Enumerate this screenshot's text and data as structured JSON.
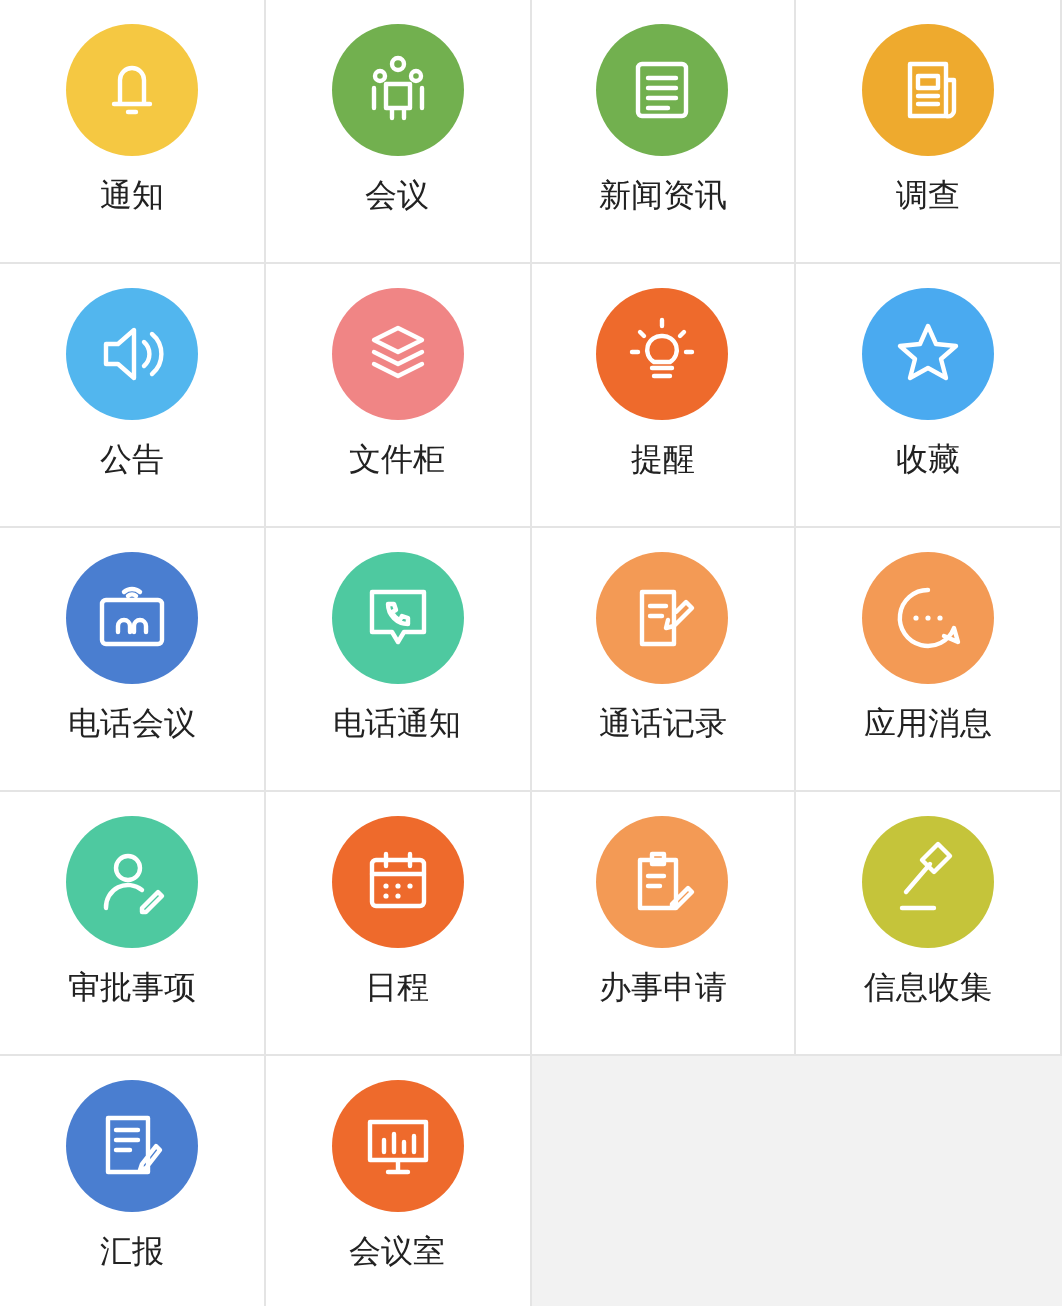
{
  "tiles": [
    {
      "label": "通知",
      "kind": "bell",
      "color": "#f5c842"
    },
    {
      "label": "会议",
      "kind": "meeting",
      "color": "#72b04f"
    },
    {
      "label": "新闻资讯",
      "kind": "list",
      "color": "#72b04f"
    },
    {
      "label": "调查",
      "kind": "newspaper",
      "color": "#eeaa2e"
    },
    {
      "label": "公告",
      "kind": "speaker",
      "color": "#52b6ee"
    },
    {
      "label": "文件柜",
      "kind": "layers",
      "color": "#f08585"
    },
    {
      "label": "提醒",
      "kind": "bulb",
      "color": "#ee6a2c"
    },
    {
      "label": "收藏",
      "kind": "star",
      "color": "#4aaaf0"
    },
    {
      "label": "电话会议",
      "kind": "tablet",
      "color": "#4a7ed0"
    },
    {
      "label": "电话通知",
      "kind": "phone",
      "color": "#4ec9a0"
    },
    {
      "label": "通话记录",
      "kind": "note",
      "color": "#f39a55"
    },
    {
      "label": "应用消息",
      "kind": "chat",
      "color": "#f39a55"
    },
    {
      "label": "审批事项",
      "kind": "person",
      "color": "#4ec9a0"
    },
    {
      "label": "日程",
      "kind": "calendar",
      "color": "#ee6a2c"
    },
    {
      "label": "办事申请",
      "kind": "clipboard",
      "color": "#f39a55"
    },
    {
      "label": "信息收集",
      "kind": "hammer",
      "color": "#c5c43a"
    },
    {
      "label": "汇报",
      "kind": "document",
      "color": "#4a7ed0"
    },
    {
      "label": "会议室",
      "kind": "easel",
      "color": "#ee6a2c"
    }
  ]
}
